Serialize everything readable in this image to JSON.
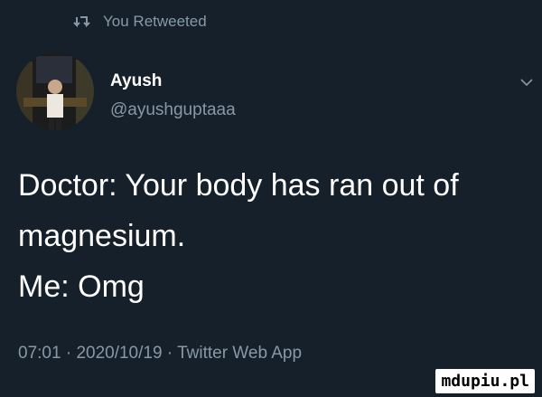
{
  "retweet": {
    "label": "You Retweeted",
    "icon": "retweet-icon"
  },
  "author": {
    "name": "Ayush",
    "handle": "@ayushguptaaa"
  },
  "tweet": {
    "text": "Doctor: Your body has ran out of\nmagnesium.\nMe: Omg"
  },
  "meta": {
    "time": "07:01",
    "date": "2020/10/19",
    "client": "Twitter Web App",
    "separator": " · "
  },
  "watermark": "mdupiu.pl",
  "colors": {
    "background": "#15202b",
    "secondary_text": "#8899a6",
    "primary_text": "#ffffff"
  }
}
